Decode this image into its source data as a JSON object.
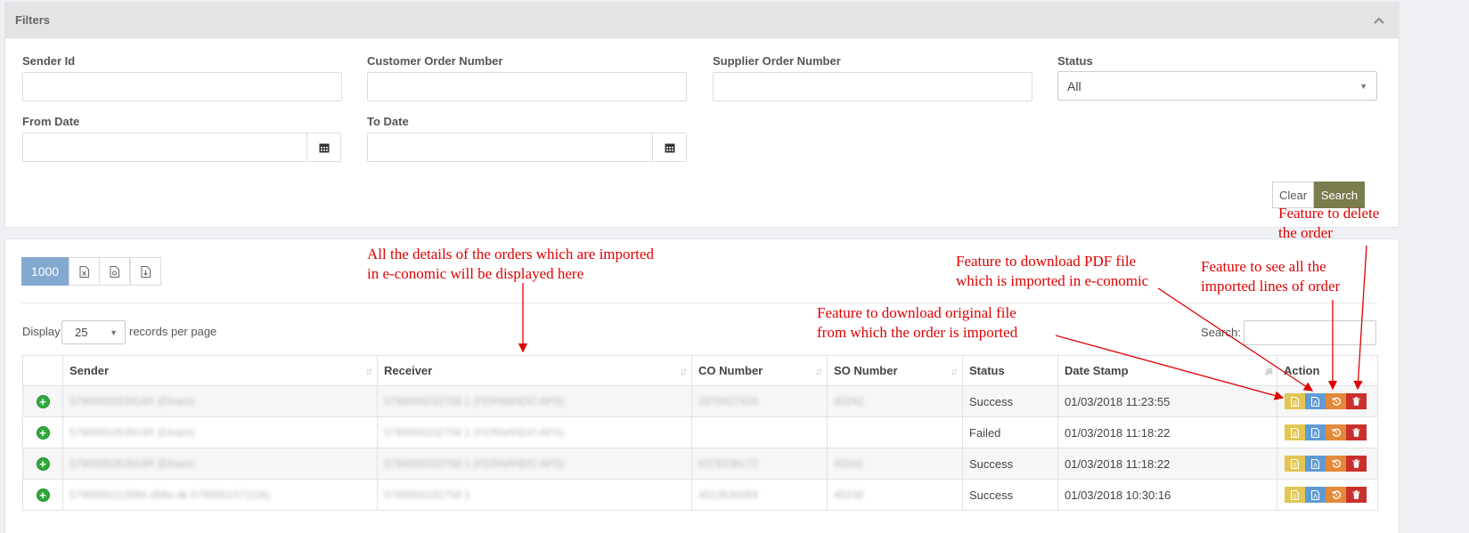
{
  "filters": {
    "title": "Filters",
    "sender_id_label": "Sender Id",
    "customer_order_label": "Customer Order Number",
    "supplier_order_label": "Supplier Order Number",
    "status_label": "Status",
    "status_value": "All",
    "from_date_label": "From Date",
    "to_date_label": "To Date",
    "clear_label": "Clear",
    "search_label": "Search"
  },
  "results": {
    "page_size_button": "1000",
    "display_label": "Display",
    "records_value": "25",
    "records_suffix": "records per page",
    "search_label": "Search:",
    "columns": [
      "Sender",
      "Receiver",
      "CO Number",
      "SO Number",
      "Status",
      "Date Stamp",
      "Action"
    ],
    "rows": [
      {
        "sender": "5790000263914R (Elnam)",
        "receiver": "5790000232758 1 (FERNANDO APS)",
        "co": "2870027428",
        "so": "40242",
        "status": "Success",
        "date": "01/03/2018 11:23:55"
      },
      {
        "sender": "5790000263914R (Elnam)",
        "receiver": "5790000232758 1 (FERNANDO APS)",
        "co": "",
        "so": "",
        "status": "Failed",
        "date": "01/03/2018 11:18:22"
      },
      {
        "sender": "5790000263914R (Elnam)",
        "receiver": "5790000232758 1 (FERNANDO APS)",
        "co": "6379238172",
        "so": "40241",
        "status": "Success",
        "date": "01/03/2018 11:18:22"
      },
      {
        "sender": "5790000212684 (Billa.dk 5790001071116)",
        "receiver": "5790000232758 1",
        "co": "4013530069",
        "so": "40238",
        "status": "Success",
        "date": "01/03/2018 10:30:16"
      }
    ]
  },
  "annotations": {
    "details": "All the details of the orders which are imported\nin e-conomic will be displayed here",
    "pdf": "Feature to download PDF file\nwhich is imported in e-conomic",
    "original": "Feature to download original file\nfrom which the order is imported",
    "lines": "Feature to see all the\nimported lines of order",
    "delete": "Feature to delete\nthe order"
  },
  "colors": {
    "search_button": "#7a7d4d",
    "page_size_button": "#83a9d0",
    "annotation": "#e00000",
    "action_yellow": "#e3c551",
    "action_blue": "#5f9bd5",
    "action_orange": "#e3893a",
    "action_red": "#c9302c"
  },
  "icons": [
    "chevron-up-icon",
    "calendar-icon",
    "excel-export-icon",
    "pdf-export-icon",
    "csv-export-icon",
    "sort-icon",
    "expand-plus-icon",
    "file-icon",
    "pdf-icon",
    "history-icon",
    "trash-icon"
  ]
}
